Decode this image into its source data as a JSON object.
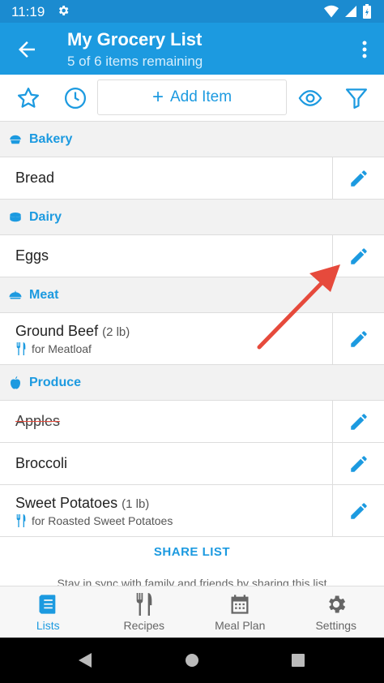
{
  "status_bar": {
    "time": "11:19"
  },
  "header": {
    "title": "My Grocery List",
    "subtitle": "5 of 6 items remaining"
  },
  "toolbar": {
    "add_label": "Add Item"
  },
  "categories": [
    {
      "name": "Bakery",
      "icon": "bakery-icon",
      "items": [
        {
          "name": "Bread"
        }
      ]
    },
    {
      "name": "Dairy",
      "icon": "dairy-icon",
      "items": [
        {
          "name": "Eggs"
        }
      ]
    },
    {
      "name": "Meat",
      "icon": "meat-icon",
      "items": [
        {
          "name": "Ground Beef",
          "qty": "(2 lb)",
          "note": "for Meatloaf"
        }
      ]
    },
    {
      "name": "Produce",
      "icon": "produce-icon",
      "items": [
        {
          "name": "Apples",
          "checked": true
        },
        {
          "name": "Broccoli"
        },
        {
          "name": "Sweet Potatoes",
          "qty": "(1 lb)",
          "note": "for Roasted Sweet Potatoes"
        }
      ]
    }
  ],
  "share": {
    "label": "SHARE LIST",
    "description": "Stay in sync with family and friends by sharing this list"
  },
  "bottom_nav": [
    {
      "label": "Lists",
      "icon": "lists-icon",
      "active": true
    },
    {
      "label": "Recipes",
      "icon": "recipes-icon",
      "active": false
    },
    {
      "label": "Meal Plan",
      "icon": "meal-plan-icon",
      "active": false
    },
    {
      "label": "Settings",
      "icon": "settings-icon",
      "active": false
    }
  ],
  "colors": {
    "primary": "#1c9ae0",
    "status_bar": "#1b8bd0",
    "annotation_arrow": "#e64a3c"
  }
}
